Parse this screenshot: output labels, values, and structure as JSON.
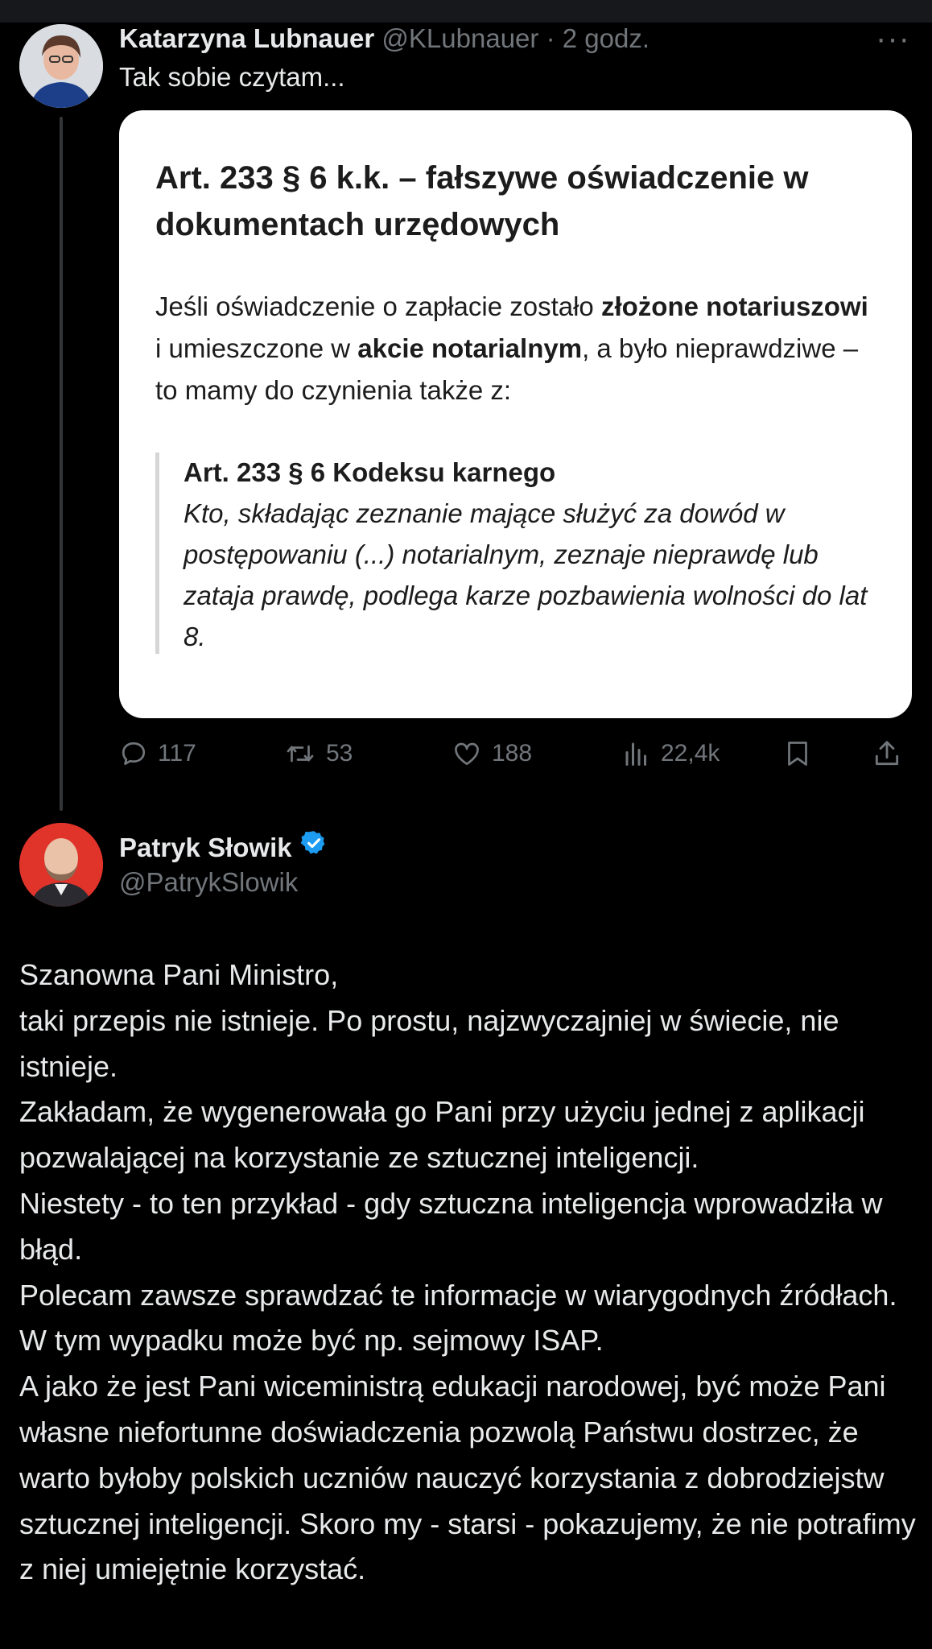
{
  "tweet1": {
    "author_name": "Katarzyna Lubnauer",
    "author_handle": "@KLubnauer",
    "separator": "·",
    "time": "2 godz.",
    "more": "···",
    "text": "Tak sobie czytam...",
    "card": {
      "title": "Art. 233 § 6 k.k. – fałszywe oświadczenie w dokumentach urzędowych",
      "body_1": "Jeśli oświadczenie o zapłacie zostało ",
      "body_bold_1": "złożone notariuszowi",
      "body_2": " i umieszczone w ",
      "body_bold_2": "akcie notarialnym",
      "body_3": ", a było nieprawdziwe – to mamy do czynienia także z:",
      "quote_title": "Art. 233 § 6 Kodeksu karnego",
      "quote_text": "Kto, składając zeznanie mające służyć za dowód w postępowaniu (...) notarialnym, zeznaje nieprawdę lub zataja prawdę, podlega karze pozbawienia wolności do lat 8."
    },
    "actions": {
      "replies": "117",
      "retweets": "53",
      "likes": "188",
      "views": "22,4k"
    },
    "icons": [
      "reply-icon",
      "retweet-icon",
      "like-icon",
      "views-icon",
      "bookmark-icon",
      "share-icon"
    ]
  },
  "tweet2": {
    "author_name": "Patryk Słowik",
    "author_handle": "@PatrykSlowik",
    "verified": true,
    "paragraphs": [
      "Szanowna Pani Ministro,",
      "taki przepis nie istnieje. Po prostu, najzwyczajniej w świecie, nie istnieje.",
      "Zakładam, że wygenerowała go Pani przy użyciu jednej z aplikacji pozwalającej na korzystanie ze sztucznej inteligencji.",
      "Niestety - to ten przykład - gdy sztuczna inteligencja wprowadziła w błąd.",
      "Polecam zawsze sprawdzać te informacje w wiarygodnych źródłach. W tym wypadku może być np. sejmowy ISAP.",
      "A jako że jest Pani wiceministrą edukacji narodowej, być może Pani własne niefortunne doświadczenia pozwolą Państwu dostrzec, że warto byłoby polskich uczniów nauczyć korzystania z dobrodziejstw sztucznej inteligencji. Skoro my - starsi - pokazujemy, że nie potrafimy z niej umiejętnie korzystać."
    ]
  },
  "colors": {
    "background": "#000000",
    "text": "#e7e9ea",
    "secondary": "#71767b",
    "verified": "#1d9bf0",
    "card": "#ffffff"
  }
}
